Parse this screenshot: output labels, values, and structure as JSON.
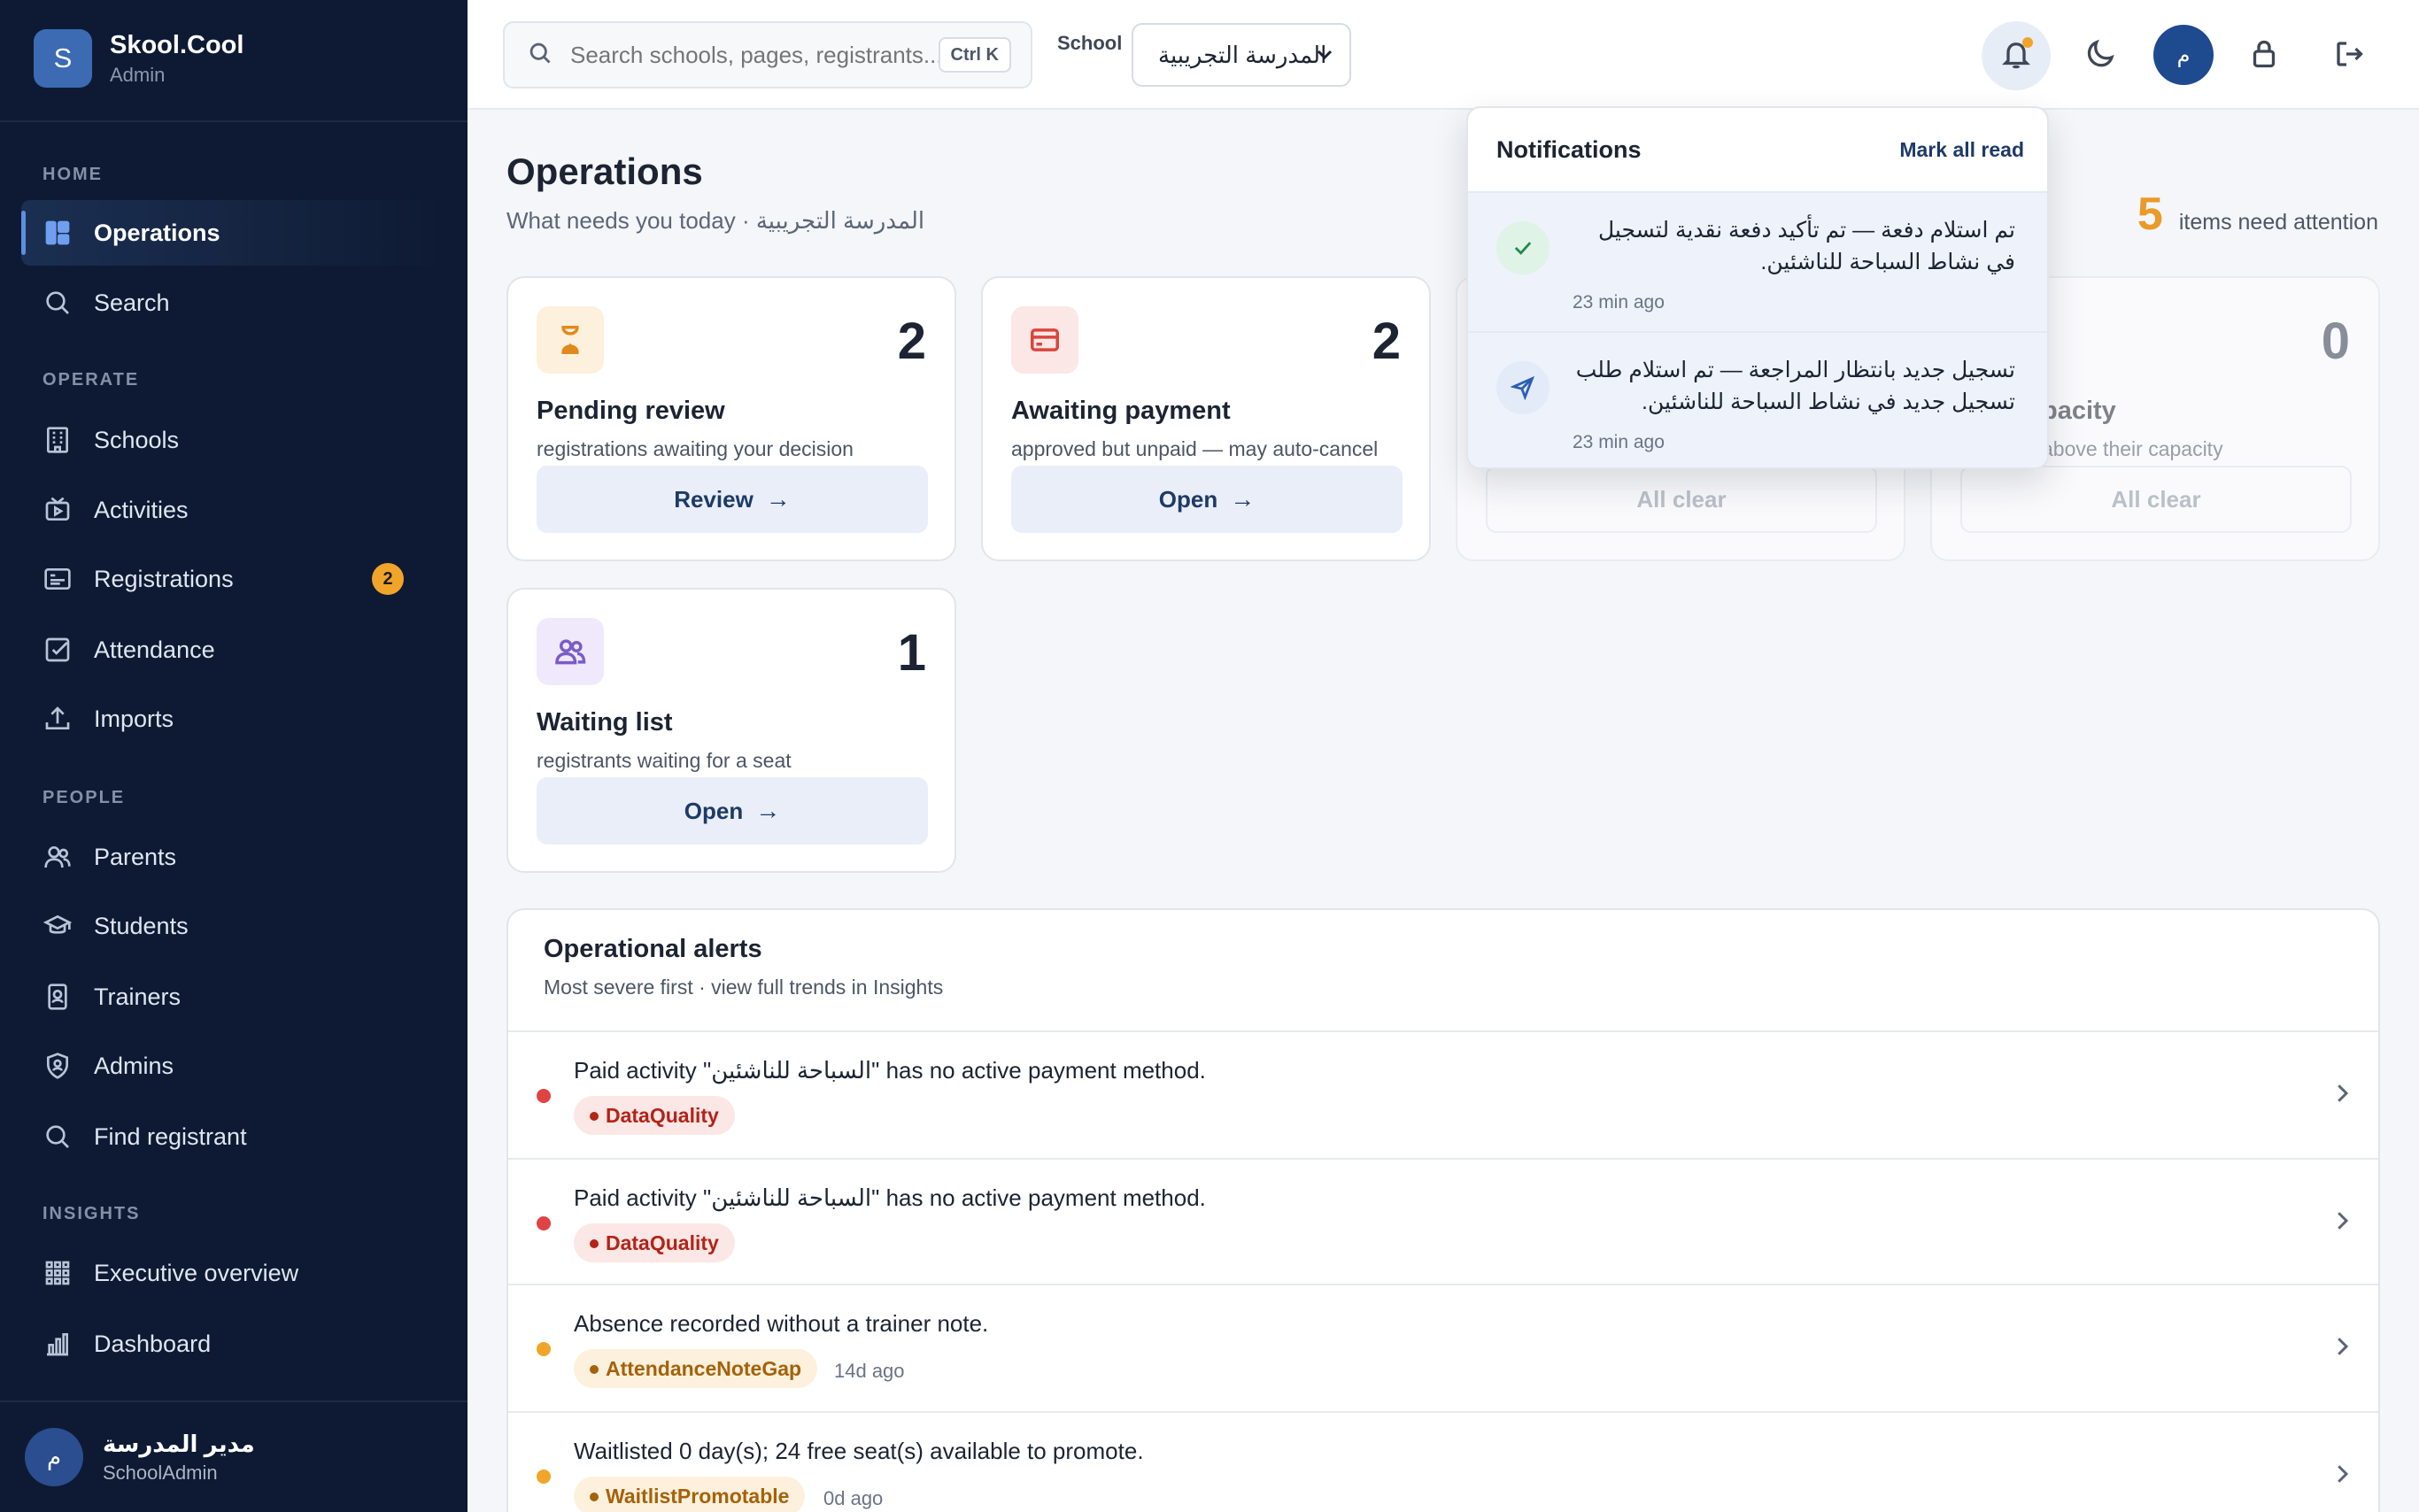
{
  "brand": {
    "initial": "S",
    "name": "Skool.Cool",
    "role": "Admin"
  },
  "sidebar": {
    "sections": [
      "HOME",
      "OPERATE",
      "PEOPLE",
      "INSIGHTS"
    ],
    "items": [
      {
        "label": "Operations",
        "icon": "dashboard-icon",
        "active": true
      },
      {
        "label": "Search",
        "icon": "search-icon"
      },
      {
        "label": "Schools",
        "icon": "building-icon"
      },
      {
        "label": "Activities",
        "icon": "activity-icon"
      },
      {
        "label": "Registrations",
        "icon": "id-card-icon",
        "badge": "2"
      },
      {
        "label": "Attendance",
        "icon": "checkbox-icon"
      },
      {
        "label": "Imports",
        "icon": "upload-icon"
      },
      {
        "label": "Parents",
        "icon": "users-icon"
      },
      {
        "label": "Students",
        "icon": "graduation-cap-icon"
      },
      {
        "label": "Trainers",
        "icon": "badge-icon"
      },
      {
        "label": "Admins",
        "icon": "shield-icon"
      },
      {
        "label": "Find registrant",
        "icon": "search-icon"
      },
      {
        "label": "Executive overview",
        "icon": "grid-icon"
      },
      {
        "label": "Dashboard",
        "icon": "bar-chart-icon"
      }
    ],
    "footer": {
      "avatar": "م",
      "name": "مدير المدرسة",
      "role": "SchoolAdmin"
    }
  },
  "topbar": {
    "search_placeholder": "Search schools, pages, registrants...",
    "shortcut": "Ctrl K",
    "school_label": "School",
    "school_value": "المدرسة التجريبية",
    "avatar": "م"
  },
  "page": {
    "title": "Operations",
    "subtitle": "What needs you today · المدرسة التجريبية",
    "attention_count": "5",
    "attention_text": "items need attention"
  },
  "cards": [
    {
      "count": "2",
      "title": "Pending review",
      "desc": "registrations awaiting your decision",
      "button": "Review",
      "icon": "hourglass-icon"
    },
    {
      "count": "2",
      "title": "Awaiting payment",
      "desc": "approved but unpaid — may auto-cancel",
      "button": "Open",
      "icon": "credit-card-icon"
    },
    {
      "count": "",
      "title": "",
      "desc": "",
      "button": "All clear"
    },
    {
      "count": "0",
      "title": "pacity",
      "desc": "above their capacity",
      "button": "All clear"
    },
    {
      "count": "1",
      "title": "Waiting list",
      "desc": "registrants waiting for a seat",
      "button": "Open",
      "icon": "users-icon"
    }
  ],
  "alerts": {
    "title": "Operational alerts",
    "subtitle": "Most severe first · view full trends in Insights",
    "rows": [
      {
        "text": "Paid activity \"السباحة للناشئين\" has no active payment method.",
        "tag": "DataQuality",
        "severity": "red",
        "age": ""
      },
      {
        "text": "Paid activity \"السباحة للناشئين\" has no active payment method.",
        "tag": "DataQuality",
        "severity": "red",
        "age": ""
      },
      {
        "text": "Absence recorded without a trainer note.",
        "tag": "AttendanceNoteGap",
        "severity": "amber",
        "age": "14d ago"
      },
      {
        "text": "Waitlisted 0 day(s); 24 free seat(s) available to promote.",
        "tag": "WaitlistPromotable",
        "severity": "amber",
        "age": "0d ago"
      }
    ]
  },
  "notifications": {
    "title": "Notifications",
    "mark_all": "Mark all read",
    "items": [
      {
        "text": "تم استلام دفعة — تم تأكيد دفعة نقدية لتسجيل في نشاط السباحة للناشئين.",
        "time": "23 min ago",
        "icon": "check-icon"
      },
      {
        "text": "تسجيل جديد بانتظار المراجعة — تم استلام طلب تسجيل جديد في نشاط السباحة للناشئين.",
        "time": "23 min ago",
        "icon": "send-icon"
      }
    ]
  },
  "colors": {
    "sidebar_bg": "#0e1a33",
    "accent": "#1e4a8f",
    "warning": "#f0a52a",
    "danger": "#e04343"
  }
}
